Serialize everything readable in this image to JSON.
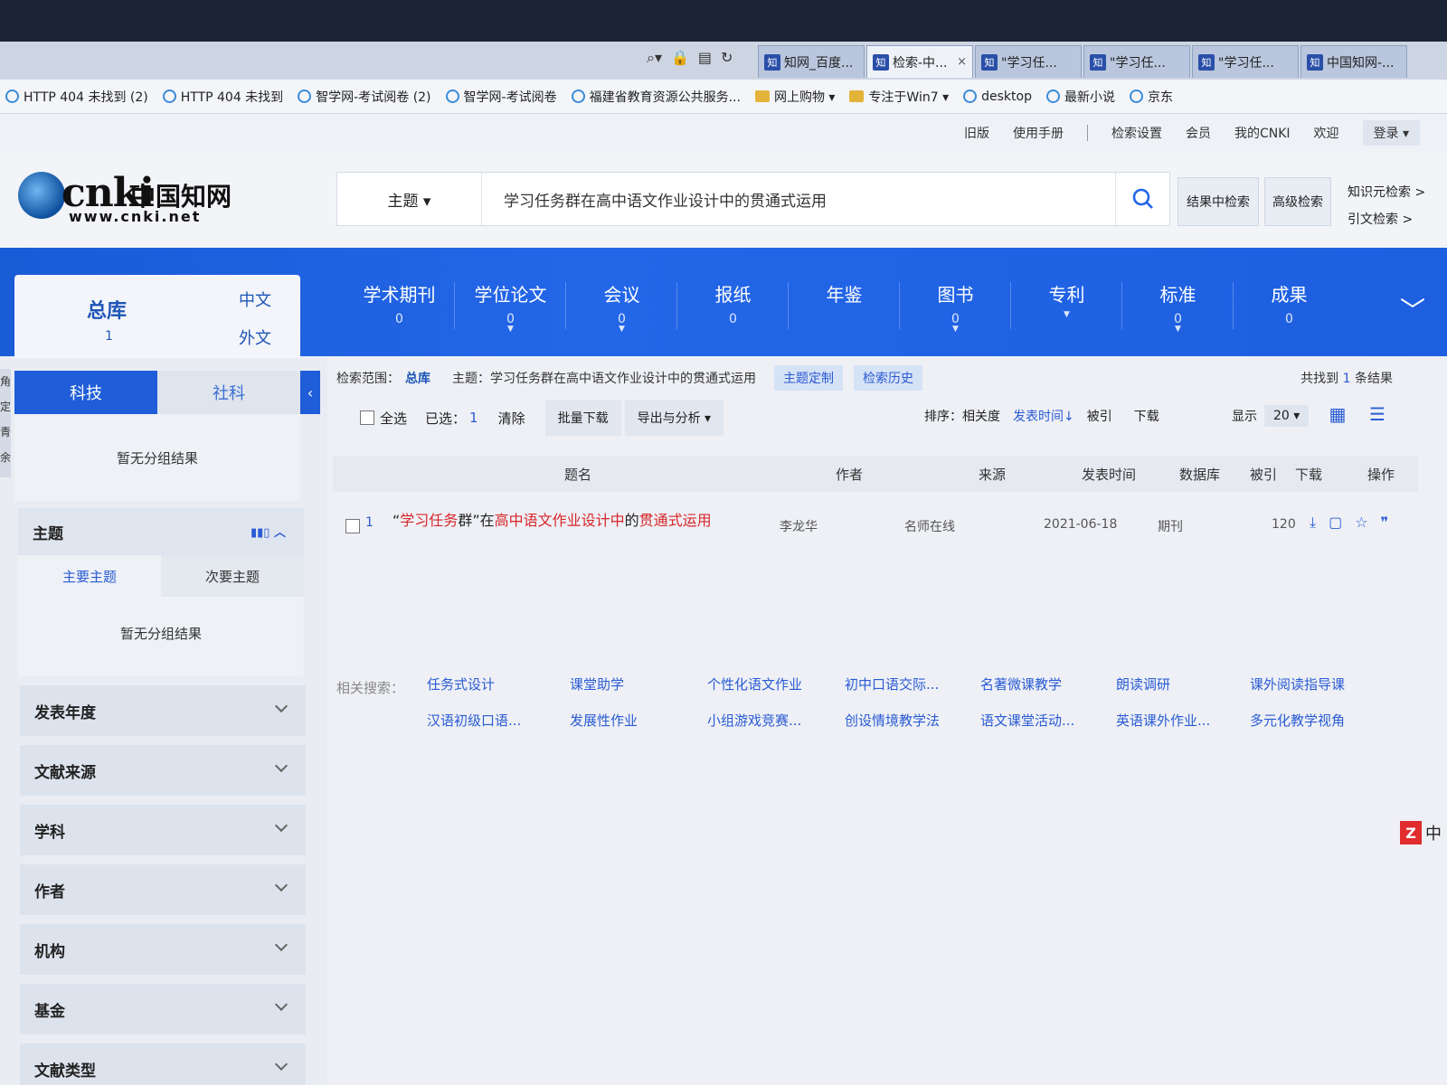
{
  "browser": {
    "tabs": [
      {
        "label": "知网_百度...",
        "icon": "baidu-icon"
      },
      {
        "label": "检索-中...",
        "icon": "cnki-icon",
        "active": true,
        "close": "×"
      },
      {
        "label": "\"学习任...",
        "icon": "cnki-icon"
      },
      {
        "label": "\"学习任...",
        "icon": "cnki-icon"
      },
      {
        "label": "\"学习任...",
        "icon": "cnki-icon"
      },
      {
        "label": "中国知网-...",
        "icon": "cnki-icon"
      }
    ],
    "favorites": [
      {
        "label": "HTTP 404 未找到 (2)",
        "type": "link"
      },
      {
        "label": "HTTP 404 未找到",
        "type": "link"
      },
      {
        "label": "智学网-考试阅卷 (2)",
        "type": "link"
      },
      {
        "label": "智学网-考试阅卷",
        "type": "link"
      },
      {
        "label": "福建省教育资源公共服务...",
        "type": "link"
      },
      {
        "label": "网上购物 ▾",
        "type": "folder"
      },
      {
        "label": "专注于Win7 ▾",
        "type": "folder"
      },
      {
        "label": "desktop",
        "type": "link"
      },
      {
        "label": "最新小说",
        "type": "link"
      },
      {
        "label": "京东",
        "type": "link"
      }
    ]
  },
  "toplinks": {
    "old": "旧版",
    "manual": "使用手册",
    "settings": "检索设置",
    "member": "会员",
    "mycnki": "我的CNKI",
    "welcome": "欢迎",
    "login": "登录 ▾"
  },
  "logo": {
    "brand": "cnki",
    "brand_cn": "中国知网",
    "url": "www.cnki.net"
  },
  "search": {
    "field": "主题 ▾",
    "query": "学习任务群在高中语文作业设计中的贯通式运用",
    "within_results": "结果中检索",
    "advanced": "高级检索",
    "knowledge_search": "知识元检索 >",
    "citation_search": "引文检索 >"
  },
  "nav": {
    "zongku": "总库",
    "zongku_count": "1",
    "chinese": "中文",
    "foreign": "外文",
    "items": [
      {
        "label": "学术期刊",
        "count": "0",
        "caret": false
      },
      {
        "label": "学位论文",
        "count": "0",
        "caret": true
      },
      {
        "label": "会议",
        "count": "0",
        "caret": true
      },
      {
        "label": "报纸",
        "count": "0",
        "caret": false
      },
      {
        "label": "年鉴",
        "count": "",
        "caret": false
      },
      {
        "label": "图书",
        "count": "0",
        "caret": true
      },
      {
        "label": "专利",
        "count": "",
        "caret": true
      },
      {
        "label": "标准",
        "count": "0",
        "caret": true
      },
      {
        "label": "成果",
        "count": "0",
        "caret": false
      }
    ]
  },
  "sidebar": {
    "edge_text": "角定青余",
    "tab_sci": "科技",
    "tab_social": "社科",
    "no_group": "暂无分组结果",
    "topic": {
      "title": "主题",
      "main": "主要主题",
      "secondary": "次要主题",
      "no_group": "暂无分组结果"
    },
    "facets": [
      "发表年度",
      "文献来源",
      "学科",
      "作者",
      "机构",
      "基金",
      "文献类型"
    ]
  },
  "results": {
    "scope_label": "检索范围：",
    "scope_value": "总库",
    "scope_topic": "主题：学习任务群在高中语文作业设计中的贯通式运用",
    "topic_custom": "主题定制",
    "history": "检索历史",
    "total_prefix": "共找到",
    "total_count": "1",
    "total_suffix": "条结果",
    "select_all": "全选",
    "selected_label": "已选：",
    "selected_count": "1",
    "clear": "清除",
    "batch_download": "批量下载",
    "export": "导出与分析 ▾",
    "sort_label": "排序：相关度",
    "sort_date": "发表时间↓",
    "sort_cited": "被引",
    "sort_download": "下载",
    "show_label": "显示",
    "page_size": "20 ▾",
    "columns": {
      "title": "题名",
      "author": "作者",
      "source": "来源",
      "date": "发表时间",
      "db": "数据库",
      "cited": "被引",
      "download": "下载",
      "ops": "操作"
    },
    "rows": [
      {
        "index": "1",
        "title_parts": [
          {
            "t": "“",
            "hl": false
          },
          {
            "t": "学习任务",
            "hl": true
          },
          {
            "t": "群”在",
            "hl": false
          },
          {
            "t": "高中语文作业设计中",
            "hl": true
          },
          {
            "t": "的",
            "hl": false
          },
          {
            "t": "贯通式运用",
            "hl": true
          }
        ],
        "author": "李龙华",
        "source": "名师在线",
        "date": "2021-06-18",
        "db": "期刊",
        "cited": "",
        "download": "120"
      }
    ],
    "related_label": "相关搜索：",
    "related": [
      [
        "任务式设计",
        "课堂助学",
        "个性化语文作业",
        "初中口语交际...",
        "名著微课教学",
        "朗读调研",
        "课外阅读指导课"
      ],
      [
        "汉语初级口语...",
        "发展性作业",
        "小组游戏竞赛...",
        "创设情境教学法",
        "语文课堂活动...",
        "英语课外作业...",
        "多元化教学视角"
      ]
    ],
    "corner_badge": "Z",
    "corner_text": "中"
  },
  "colors": {
    "accent": "#2366e8",
    "highlight": "#d7262b",
    "link": "#2a5bd4"
  }
}
